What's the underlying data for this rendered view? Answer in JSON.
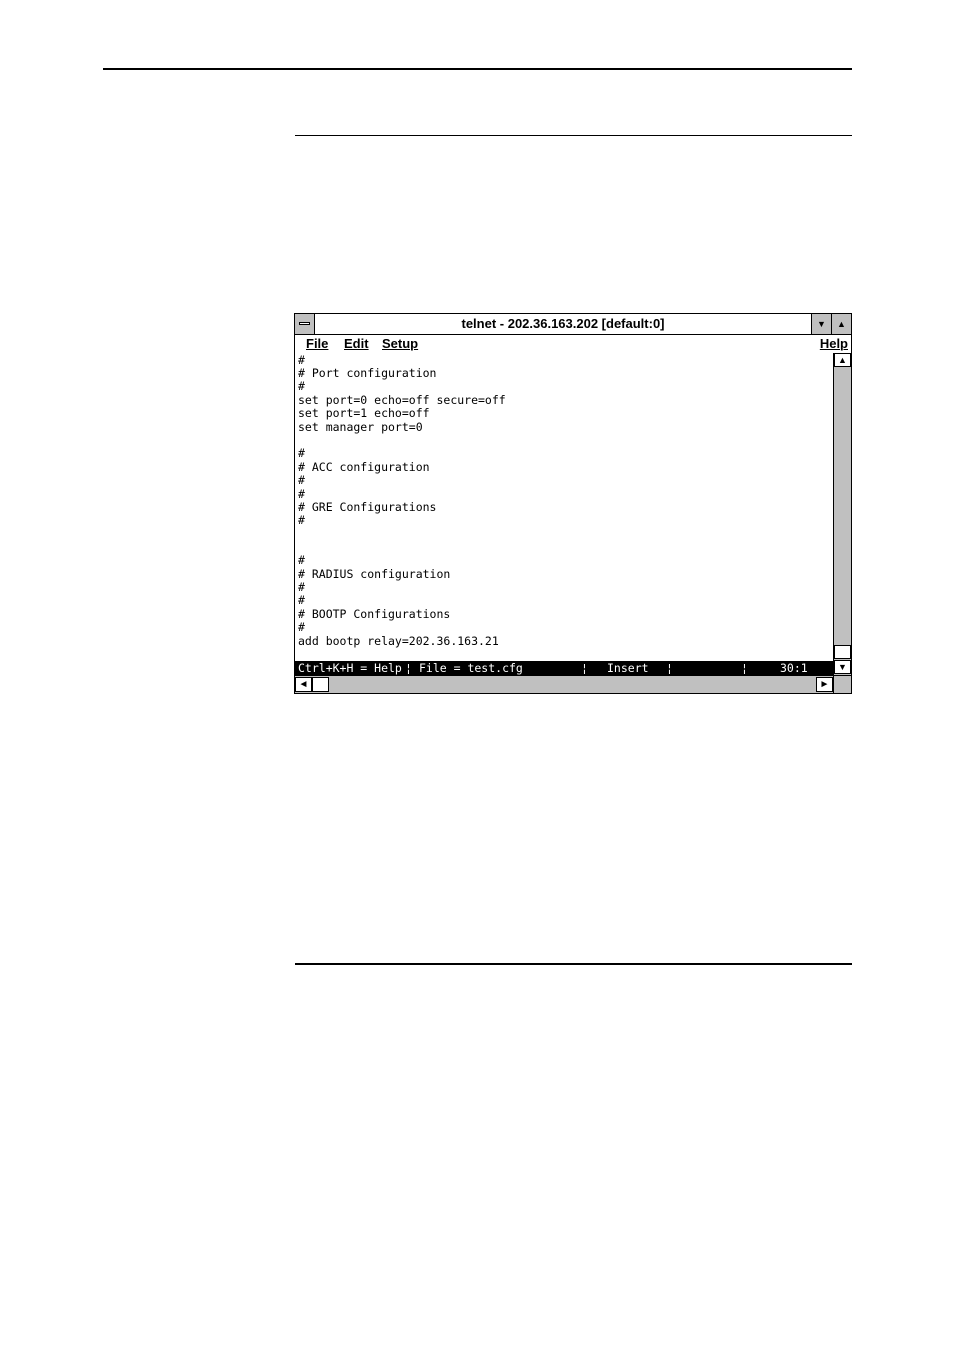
{
  "window": {
    "title": "telnet - 202.36.163.202 [default:0]",
    "menu": [
      "File",
      "Edit",
      "Setup"
    ],
    "help_menu": "Help"
  },
  "editor": {
    "lines": [
      "#",
      "# Port configuration",
      "#",
      "set port=0 echo=off secure=off",
      "set port=1 echo=off",
      "set manager port=0",
      "#",
      "# ACC configuration",
      "#",
      "#",
      "# GRE Configurations",
      "#",
      "#",
      "# RADIUS configuration",
      "#",
      "#",
      "# BOOTP Configurations",
      "#",
      "add bootp relay=202.36.163.21"
    ]
  },
  "status": {
    "help": "Ctrl+K+H = Help",
    "file": "File = test.cfg",
    "mode": "Insert",
    "position": "30:1",
    "separator": "¦"
  },
  "icons": {
    "system_menu": "system-menu-icon",
    "minimize": "minimize-icon",
    "maximize": "maximize-icon",
    "scroll_up": "arrow-up-icon",
    "scroll_down": "arrow-down-icon",
    "scroll_left": "arrow-left-icon",
    "scroll_right": "arrow-right-icon"
  }
}
